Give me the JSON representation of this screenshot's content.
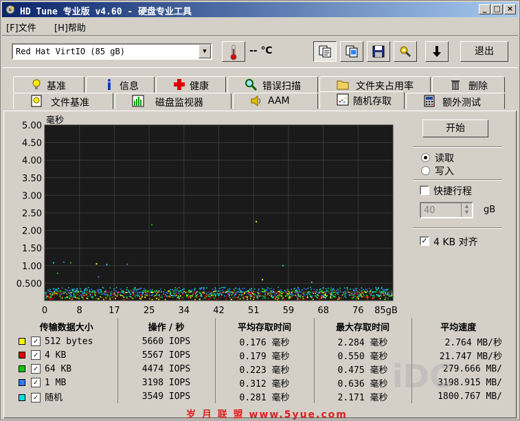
{
  "window": {
    "title": "HD Tune 专业版 v4.60 - 硬盘专业工具",
    "controls": [
      "_",
      "□",
      "×"
    ]
  },
  "menu": [
    {
      "label": "[F]文件"
    },
    {
      "label": "[H]帮助"
    }
  ],
  "toolbar": {
    "drive": "Red Hat VirtIO (85 gB)",
    "temperature": "-- ℃",
    "exit_label": "退出"
  },
  "tabs_row1": [
    {
      "label": "基准",
      "icon": "lightbulb-icon"
    },
    {
      "label": "信息",
      "icon": "info-icon"
    },
    {
      "label": "健康",
      "icon": "health-cross-icon"
    },
    {
      "label": "错误扫描",
      "icon": "magnifier-icon"
    },
    {
      "label": "文件夹占用率",
      "icon": "folder-icon"
    },
    {
      "label": "删除",
      "icon": "trash-icon"
    }
  ],
  "tabs_row2": [
    {
      "label": "文件基准",
      "icon": "file-bulb-icon"
    },
    {
      "label": "磁盘监视器",
      "icon": "bar-monitor-icon"
    },
    {
      "label": "AAM",
      "icon": "speaker-icon"
    },
    {
      "label": "随机存取",
      "icon": "scatter-icon",
      "active": true
    },
    {
      "label": "额外测试",
      "icon": "calculator-icon"
    }
  ],
  "controls": {
    "start_label": "开始",
    "read_label": "读取",
    "write_label": "写入",
    "mode_selected": "read",
    "short_stroke_label": "快捷行程",
    "short_stroke_checked": false,
    "stroke_value": "40",
    "stroke_unit": "gB",
    "align_label": "4 KB 对齐",
    "align_checked": true
  },
  "chart_data": {
    "type": "scatter",
    "ylabel": "毫秒",
    "y_ticks": [
      "5.00",
      "4.50",
      "4.00",
      "3.50",
      "3.00",
      "2.50",
      "2.00",
      "1.50",
      "1.00",
      "0.500"
    ],
    "y_tick_values": [
      5.0,
      4.5,
      4.0,
      3.5,
      3.0,
      2.5,
      2.0,
      1.5,
      1.0,
      0.5
    ],
    "x_ticks": [
      "0",
      "8",
      "17",
      "25",
      "34",
      "42",
      "51",
      "59",
      "68",
      "76",
      "85gB"
    ],
    "x_tick_values": [
      0,
      8.5,
      17,
      25.5,
      34,
      42.5,
      51,
      59.5,
      68,
      76.5,
      85
    ],
    "xlim": [
      0,
      85
    ],
    "ylim": [
      0,
      5
    ],
    "grid": true,
    "background": "#1a1a1a",
    "series": [
      {
        "name": "512 bytes",
        "color": "#ffff00",
        "band": [
          0.05,
          0.3
        ]
      },
      {
        "name": "4 KB",
        "color": "#e00000",
        "band": [
          0.05,
          0.28
        ]
      },
      {
        "name": "64 KB",
        "color": "#00cc00",
        "band": [
          0.08,
          0.35
        ]
      },
      {
        "name": "1 MB",
        "color": "#2e7cff",
        "band": [
          0.15,
          0.38
        ]
      },
      {
        "name": "随机",
        "color": "#00e0e0",
        "band": [
          0.1,
          0.4
        ]
      }
    ],
    "outliers": [
      {
        "x": 2,
        "y": 1.1
      },
      {
        "x": 4.5,
        "y": 1.12
      },
      {
        "x": 6.2,
        "y": 1.1
      },
      {
        "x": 12.5,
        "y": 1.07
      },
      {
        "x": 15,
        "y": 1.05
      },
      {
        "x": 20,
        "y": 1.06
      },
      {
        "x": 26,
        "y": 2.18
      },
      {
        "x": 51.5,
        "y": 2.27
      },
      {
        "x": 58,
        "y": 1.02
      },
      {
        "x": 13,
        "y": 0.7
      },
      {
        "x": 3,
        "y": 0.8
      },
      {
        "x": 53,
        "y": 0.62
      },
      {
        "x": 65,
        "y": 0.55
      }
    ]
  },
  "results": {
    "headers": [
      "传输数据大小",
      "操作 / 秒",
      "平均存取时间",
      "最大存取时间",
      "平均速度"
    ],
    "rows": [
      {
        "label": "512 bytes",
        "color": "#ffff00",
        "ops": "5660 IOPS",
        "avg": "0.176 毫秒",
        "max": "2.284 毫秒",
        "speed": "2.764 MB/秒"
      },
      {
        "label": "4 KB",
        "color": "#e00000",
        "ops": "5567 IOPS",
        "avg": "0.179 毫秒",
        "max": "0.550 毫秒",
        "speed": "21.747 MB/秒"
      },
      {
        "label": "64 KB",
        "color": "#00cc00",
        "ops": "4474 IOPS",
        "avg": "0.223 毫秒",
        "max": "0.475 毫秒",
        "speed": "279.666 MB/"
      },
      {
        "label": "1 MB",
        "color": "#2e7cff",
        "ops": "3198 IOPS",
        "avg": "0.312 毫秒",
        "max": "0.636 毫秒",
        "speed": "3198.915 MB/"
      },
      {
        "label": "随机",
        "color": "#00e0e0",
        "ops": "3549 IOPS",
        "avg": "0.281 毫秒",
        "max": "2.171 毫秒",
        "speed": "1800.767 MB/"
      }
    ]
  },
  "watermark": "岁 月 联 盟  www.5yue.com"
}
